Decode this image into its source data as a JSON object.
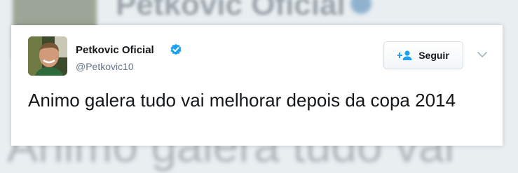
{
  "background": {
    "name_echo": "Petkovic Oficial",
    "text_echo": "Animo galera tudo vai"
  },
  "tweet": {
    "author_name": "Petkovic Oficial",
    "author_handle": "@Petkovic10",
    "verified": true,
    "follow_label": "Seguir",
    "text": "Animo galera tudo vai melhorar depois da copa 2014"
  },
  "icons": {
    "verified": "verified-badge-icon",
    "follow": "add-user-icon",
    "menu": "chevron-down-icon"
  },
  "colors": {
    "verified_blue": "#1da1f2",
    "follow_icon_blue": "#1da1f2",
    "text_primary": "#14171a",
    "text_secondary": "#657786"
  }
}
